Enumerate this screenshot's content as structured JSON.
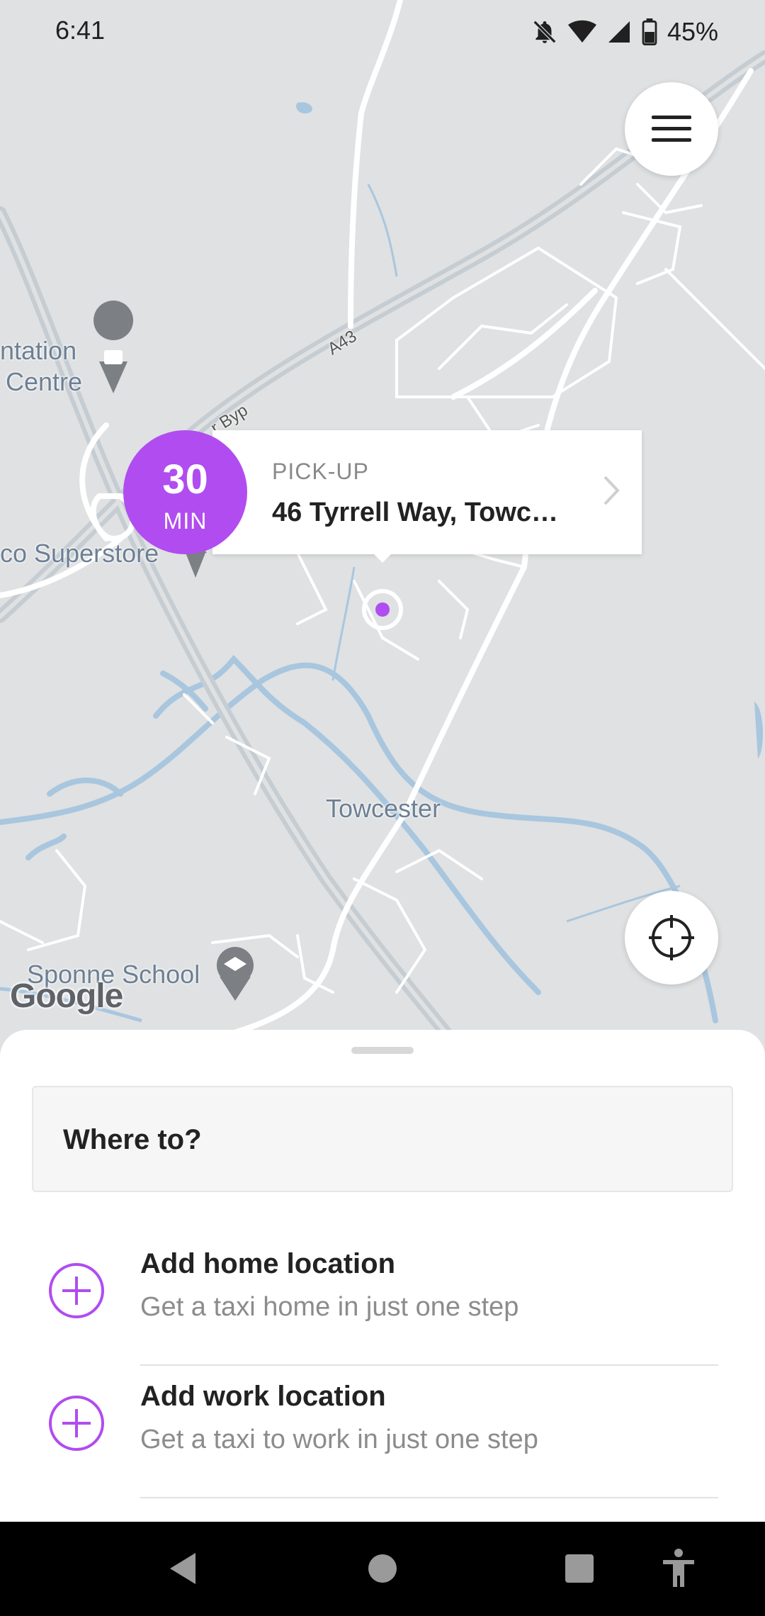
{
  "status_bar": {
    "time": "6:41",
    "battery": "45%",
    "icons": [
      "bell-off-icon",
      "wifi-icon",
      "cell-signal-icon",
      "battery-icon"
    ]
  },
  "map": {
    "labels": {
      "plantation_centre_1": "ntation",
      "plantation_centre_2": "Centre",
      "superstore": "co Superstore",
      "towcester": "Towcester",
      "sponne_school": "Sponne School",
      "road_a43": "A43",
      "road_byp": "r Byp"
    },
    "attribution": "Google",
    "pickup": {
      "eta_value": "30",
      "eta_unit": "MIN",
      "label": "PICK-UP",
      "address": "46 Tyrrell Way, Towc…"
    }
  },
  "sheet": {
    "search_placeholder": "Where to?",
    "locations": [
      {
        "title": "Add home location",
        "subtitle": "Get a taxi home in just one step"
      },
      {
        "title": "Add work location",
        "subtitle": "Get a taxi to work in just one step"
      }
    ]
  },
  "colors": {
    "accent": "#b04cf0",
    "map_bg": "#dfe1e2",
    "water": "#a9c6df",
    "road": "#ffffff",
    "major_road": "#c5cdd3"
  }
}
